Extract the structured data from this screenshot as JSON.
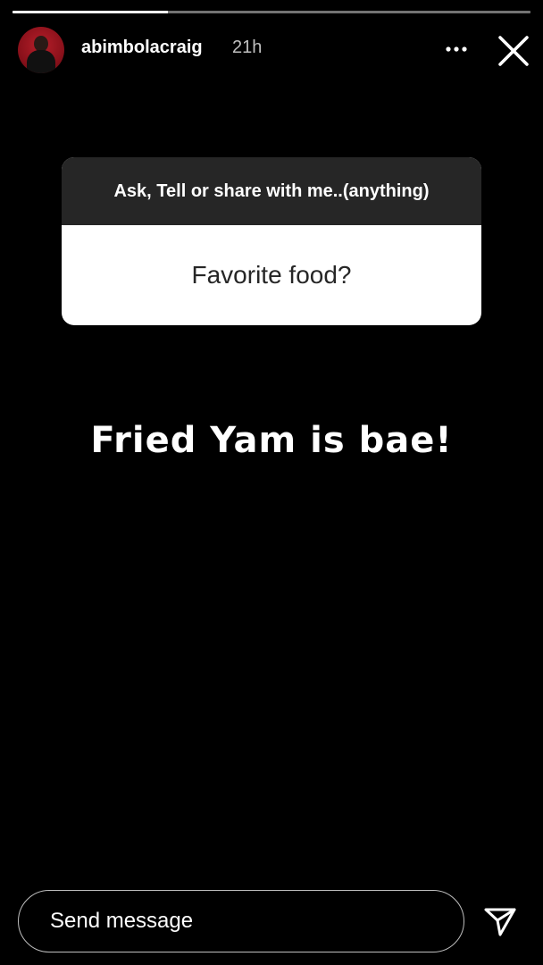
{
  "story": {
    "segments_total": 1,
    "segments_completed": 0,
    "progress_current": 0.3
  },
  "header": {
    "username": "abimbolacraig",
    "time": "21h",
    "more_icon": "more-horizontal-icon",
    "close_icon": "close-icon"
  },
  "question_sticker": {
    "prompt": "Ask, Tell or share with me..(anything)",
    "answer": "Favorite food?"
  },
  "story_text": "Fried Yam is bae!",
  "reply": {
    "placeholder": "Send message",
    "send_icon": "send-icon"
  },
  "colors": {
    "background": "#000000",
    "avatar": "#b61f2a",
    "prompt_bg": "#262626",
    "card_bg": "#ffffff"
  }
}
